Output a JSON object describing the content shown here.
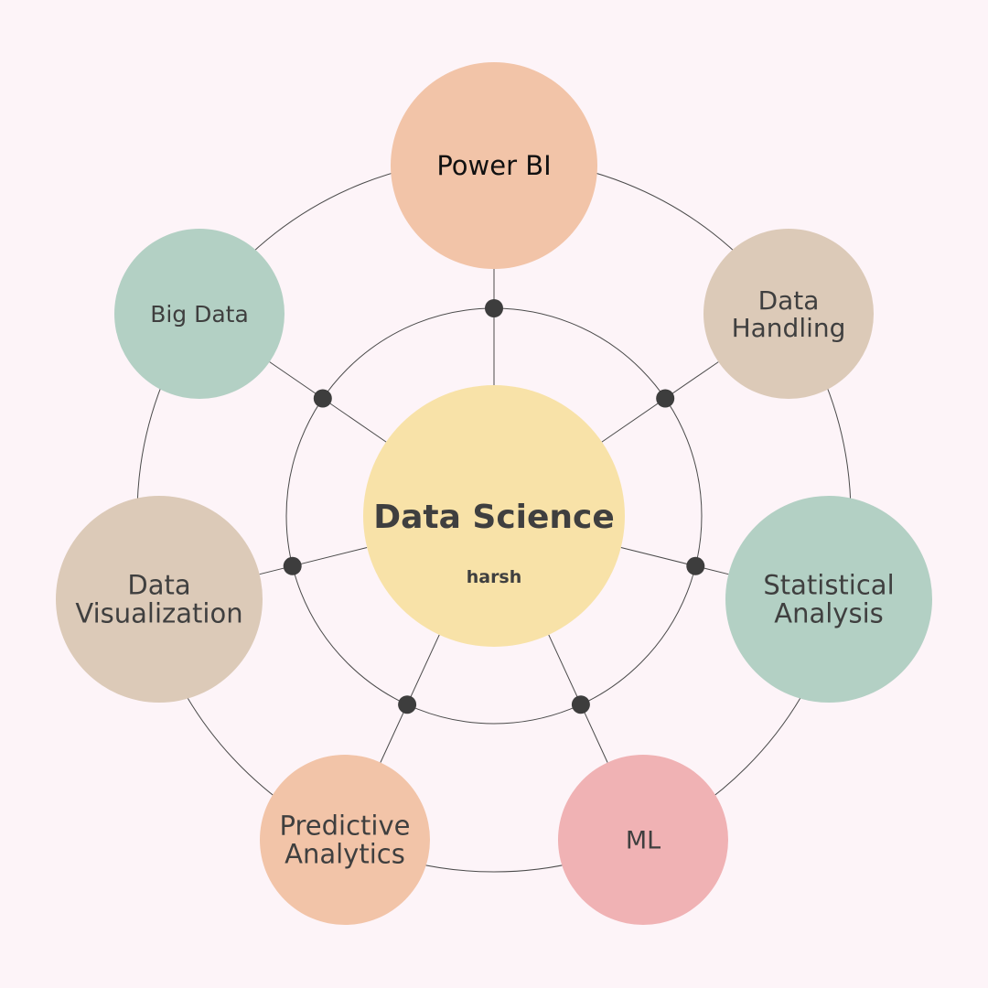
{
  "center": {
    "title": "Data Science",
    "subtitle": "harsh",
    "color": "#f8e2a8"
  },
  "nodes": [
    {
      "id": "power-bi",
      "lines": [
        "Power BI"
      ],
      "color": "#f2c4a8"
    },
    {
      "id": "data-handling",
      "lines": [
        "Data",
        "Handling"
      ],
      "color": "#dccab8"
    },
    {
      "id": "statistical-analysis",
      "lines": [
        "Statistical",
        "Analysis"
      ],
      "color": "#b3d0c4"
    },
    {
      "id": "ml",
      "lines": [
        "ML"
      ],
      "color": "#f0b2b4"
    },
    {
      "id": "predictive-analytics",
      "lines": [
        "Predictive",
        "Analytics"
      ],
      "color": "#f2c4a8"
    },
    {
      "id": "data-visualization",
      "lines": [
        "Data",
        "Visualization"
      ],
      "color": "#dccab8"
    },
    {
      "id": "big-data",
      "lines": [
        "Big Data"
      ],
      "color": "#b3d0c4"
    }
  ],
  "colors": {
    "background": "#fdf4f8",
    "line": "#4a4a4a",
    "dot": "#3d3d3d",
    "text": "#3f3f3f",
    "title_text": "#111111"
  }
}
